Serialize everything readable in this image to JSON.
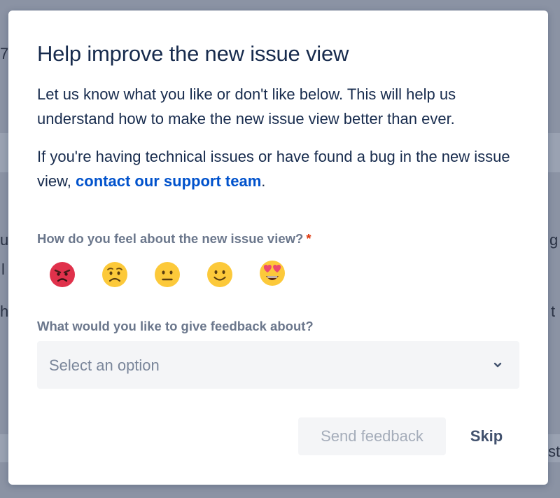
{
  "modal": {
    "title": "Help improve the new issue view",
    "paragraph1": "Let us know what you like or don't like below. This will help us understand how to make the new issue view better than ever.",
    "paragraph2_prefix": "If you're having technical issues or have found a bug in the new issue view, ",
    "paragraph2_link": "contact our support team",
    "paragraph2_suffix": ".",
    "feel_question": "How do you feel about the new issue view?",
    "required_marker": "*",
    "emojis": [
      "angry-face",
      "frowning-face",
      "neutral-face",
      "slightly-smiling-face",
      "heart-eyes-face"
    ],
    "feedback_question": "What would you like to give feedback about?",
    "select": {
      "placeholder": "Select an option"
    },
    "buttons": {
      "send": "Send feedback",
      "skip": "Skip"
    }
  },
  "background_fragments": [
    "7",
    "u",
    "l",
    "ha",
    "g",
    "t",
    "st"
  ],
  "colors": {
    "title": "#172b4d",
    "link": "#0052cc",
    "label": "#6b778c",
    "required": "#de350b",
    "select_bg": "#f4f5f7",
    "overlay": "#8b93a4"
  }
}
